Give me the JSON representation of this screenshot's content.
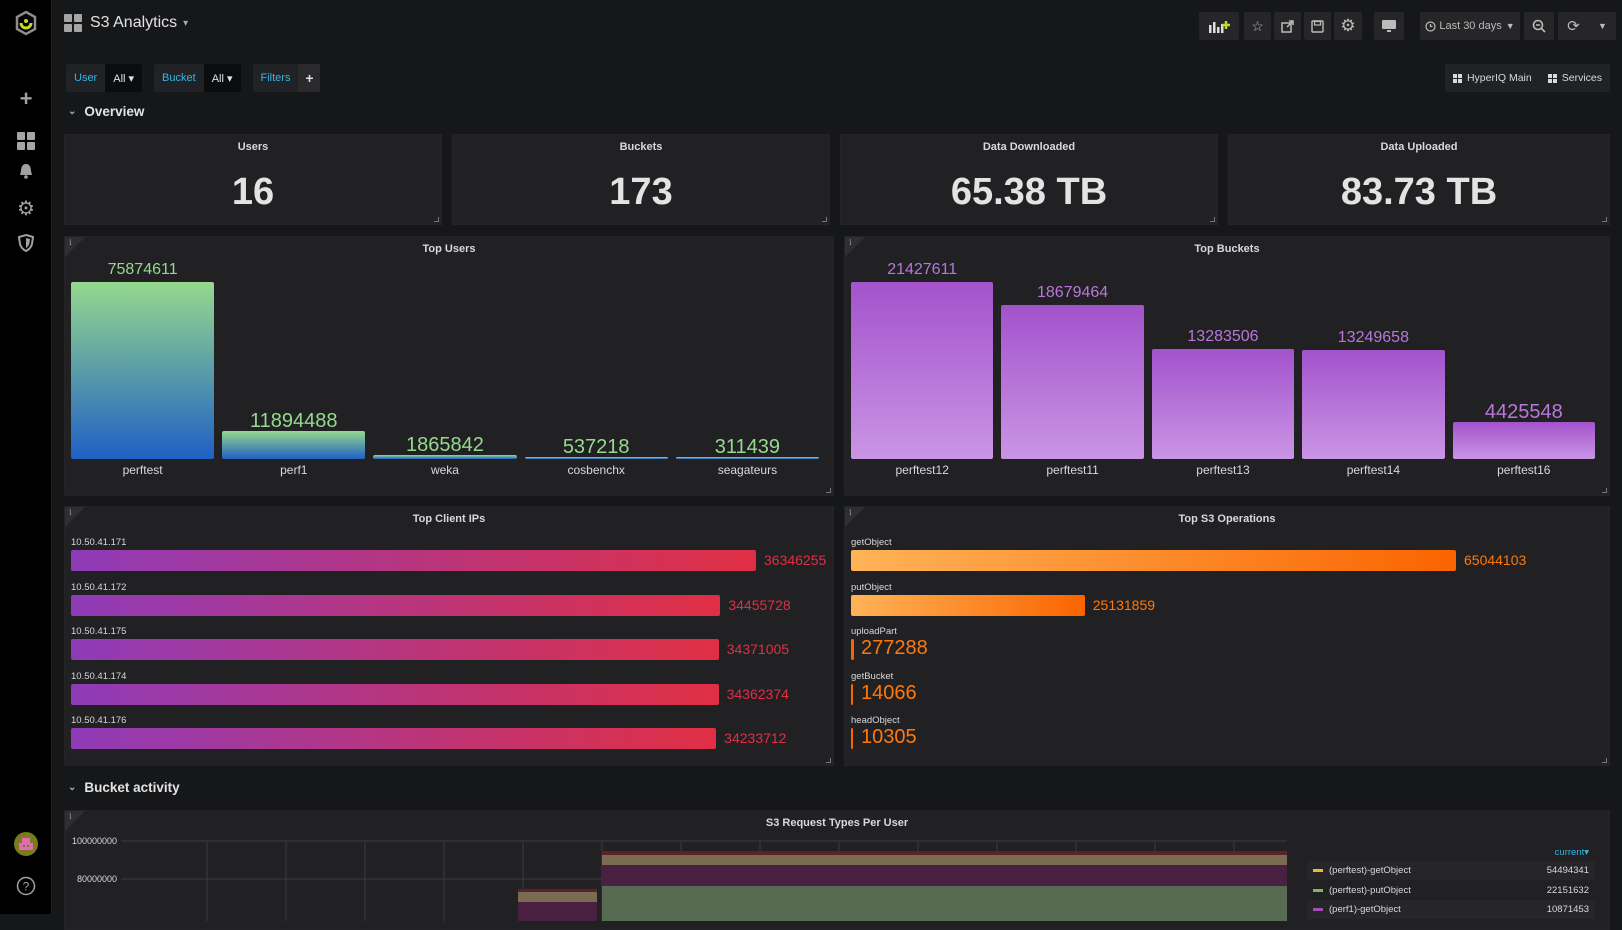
{
  "sidebar": {
    "items": [
      {
        "name": "logo-icon"
      },
      {
        "name": "create-icon",
        "glyph": "+"
      },
      {
        "name": "dashboards-icon"
      },
      {
        "name": "alerting-icon",
        "glyph": "🔔"
      },
      {
        "name": "configuration-icon",
        "glyph": "⚙"
      },
      {
        "name": "server-admin-icon",
        "glyph": "⛉"
      }
    ],
    "help_glyph": "?"
  },
  "header": {
    "title": "S3 Analytics",
    "caret": "▾",
    "time_range": "Last 30 days",
    "toolbar": {
      "add_panel": "add-panel",
      "star": "☆",
      "share": "↗",
      "save": "💾",
      "settings": "⚙",
      "tv": "🖵",
      "clock": "⏱",
      "zoom_out": "⊖",
      "refresh": "⟳",
      "refresh_caret": "▾"
    }
  },
  "variables": [
    {
      "label": "User",
      "value": "All ▾"
    },
    {
      "label": "Bucket",
      "value": "All ▾"
    }
  ],
  "filters": {
    "label": "Filters",
    "add": "+"
  },
  "dash_links": [
    {
      "label": "HyperIQ Main"
    },
    {
      "label": "Services"
    }
  ],
  "rows": {
    "overview": "Overview",
    "bucket_activity": "Bucket activity",
    "chev": "⌄"
  },
  "stats": [
    {
      "title": "Users",
      "value": "16"
    },
    {
      "title": "Buckets",
      "value": "173"
    },
    {
      "title": "Data Downloaded",
      "value": "65.38 TB"
    },
    {
      "title": "Data Uploaded",
      "value": "83.73 TB"
    }
  ],
  "chart_data": [
    {
      "type": "bar",
      "title": "Top Users",
      "categories": [
        "perftest",
        "perf1",
        "weka",
        "cosbenchx",
        "seagateurs"
      ],
      "values": [
        75874611,
        11894488,
        1865842,
        537218,
        311439
      ],
      "value_labels": [
        "75874611",
        "11894488",
        "1865842",
        "537218",
        "311439"
      ],
      "colors": {
        "top": "#96d98d",
        "bottom": "#1f60c4",
        "text": "#96d98d"
      }
    },
    {
      "type": "bar",
      "title": "Top Buckets",
      "categories": [
        "perftest12",
        "perftest11",
        "perftest13",
        "perftest14",
        "perftest16"
      ],
      "values": [
        21427611,
        18679464,
        13283506,
        13249658,
        4425548
      ],
      "value_labels": [
        "21427611",
        "18679464",
        "13283506",
        "13249658",
        "4425548"
      ],
      "colors": {
        "top": "#a352cc",
        "bottom": "#ca95e5",
        "text": "#b877d9"
      }
    },
    {
      "type": "bar",
      "orientation": "horizontal",
      "title": "Top Client IPs",
      "categories": [
        "10.50.41.171",
        "10.50.41.172",
        "10.50.41.175",
        "10.50.41.174",
        "10.50.41.176"
      ],
      "values": [
        36346255,
        34455728,
        34371005,
        34362374,
        34233712
      ],
      "value_labels": [
        "36346255",
        "34455728",
        "34371005",
        "34362374",
        "34233712"
      ],
      "colors": {
        "start": "#8f3bb8",
        "end": "#e02f44",
        "text": "#e02f44"
      }
    },
    {
      "type": "bar",
      "orientation": "horizontal",
      "title": "Top S3 Operations",
      "categories": [
        "getObject",
        "putObject",
        "uploadPart",
        "getBucket",
        "headObject"
      ],
      "values": [
        65044103,
        25131859,
        277288,
        14066,
        10305
      ],
      "value_labels": [
        "65044103",
        "25131859",
        "277288",
        "14066",
        "10305"
      ],
      "colors": {
        "start": "#ffb357",
        "end": "#fa6400",
        "text": "#ff780a"
      }
    },
    {
      "type": "area",
      "title": "S3 Request Types Per User",
      "y_ticks": [
        "100000000",
        "80000000"
      ],
      "legend_header": "current▾",
      "legend": [
        {
          "name": "(perftest)-getObject",
          "current": "54494341",
          "color": "#eab839"
        },
        {
          "name": "(perftest)-putObject",
          "current": "22151632",
          "color": "#7eb26d"
        },
        {
          "name": "(perf1)-getObject",
          "current": "10871453",
          "color": "#a04eb8"
        }
      ]
    }
  ]
}
